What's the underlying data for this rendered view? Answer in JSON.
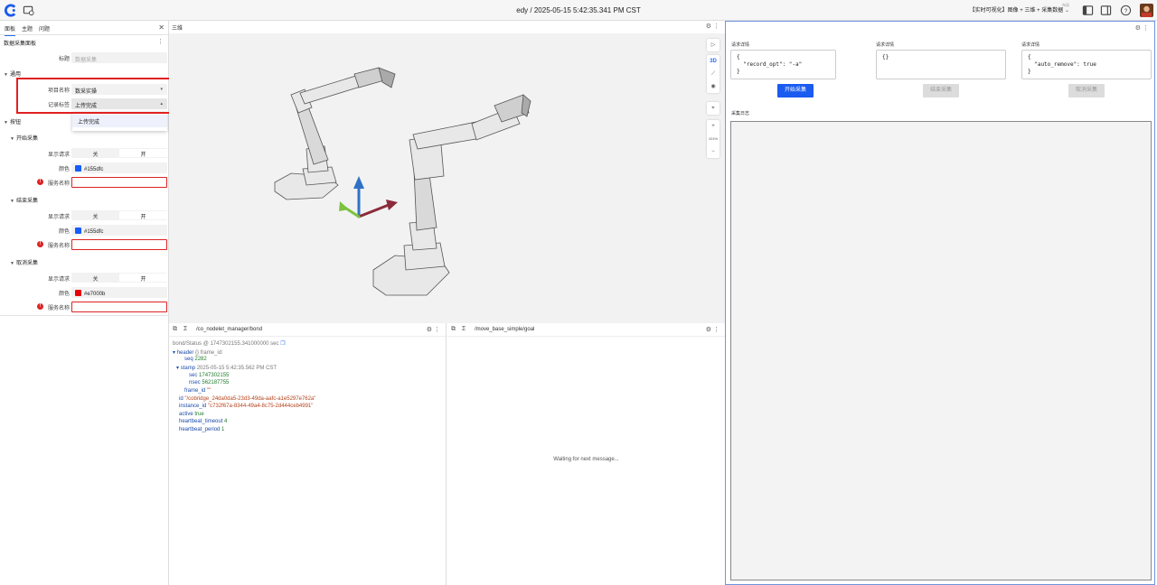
{
  "topbar": {
    "title": "edy / 2025-05-15 5:42:35.341 PM CST",
    "layout_label": "布局",
    "layout_name": "【实时可视化】图像 + 三维 + 采集数据"
  },
  "left_panel": {
    "tabs": [
      "面板",
      "主题",
      "问题"
    ],
    "panel_title": "数据采集面板",
    "title_label": "标题",
    "title_placeholder": "数据采集",
    "general": {
      "section": "通用",
      "project_label": "项目名称",
      "project_value": "数采实操",
      "record_label": "记录标签",
      "record_value": "上传完成",
      "dropdown_option": "上传完成"
    },
    "buttons_section": "按钮",
    "groups": [
      {
        "title": "开始采集",
        "show_label": "显示请求",
        "off": "关",
        "on": "开",
        "color_label": "颜色",
        "color": "#155dfc",
        "service_label": "服务名称"
      },
      {
        "title": "结束采集",
        "show_label": "显示请求",
        "off": "关",
        "on": "开",
        "color_label": "颜色",
        "color": "#155dfc",
        "service_label": "服务名称"
      },
      {
        "title": "取消采集",
        "show_label": "显示请求",
        "off": "关",
        "on": "开",
        "color_label": "颜色",
        "color": "#e7000b",
        "service_label": "服务名称"
      }
    ]
  },
  "panel3d": {
    "title": "三维",
    "tools": [
      "3D",
      "101%"
    ]
  },
  "raw_panel": {
    "topic": "/co_nodelet_manager/bond",
    "stamp_line": "bond/Status @ 1747302155.341000000 sec",
    "header_key": "header",
    "header_hint": "{} frame_id:",
    "seq_key": "seq",
    "seq_val": "2282",
    "stamp_key": "stamp",
    "stamp_hint": "2025-05-15 5:42:35.562 PM CST",
    "sec_key": "sec",
    "sec_val": "1747302155",
    "nsec_key": "nsec",
    "nsec_val": "562187755",
    "frame_key": "frame_id",
    "frame_val": "\"\"",
    "id_key": "id",
    "id_val": "\"/cobridge_24da0da5-23d3-49da-aafc-a1e5297e762a\"",
    "instance_key": "instance_id",
    "instance_val": "\"c732f67a-8344-49a4-8c75-2d444ceb4991\"",
    "active_key": "active",
    "active_val": "true",
    "hb_timeout_key": "heartbeat_timeout",
    "hb_timeout_val": "4",
    "hb_period_key": "heartbeat_period",
    "hb_period_val": "1"
  },
  "goal_panel": {
    "topic": "/move_base_simple/goal",
    "waiting": "Waiting for next message..."
  },
  "collect_panel": {
    "columns": [
      {
        "label": "请求详情",
        "json": "{\n  \"record_opt\": \"-a\"\n}",
        "button": "开始采集",
        "enabled": true
      },
      {
        "label": "请求详情",
        "json": "{}",
        "button": "结束采集",
        "enabled": false
      },
      {
        "label": "请求详情",
        "json": "{\n  \"auto_remove\": true\n}",
        "button": "取消采集",
        "enabled": false
      }
    ],
    "log_label": "采集日志"
  }
}
